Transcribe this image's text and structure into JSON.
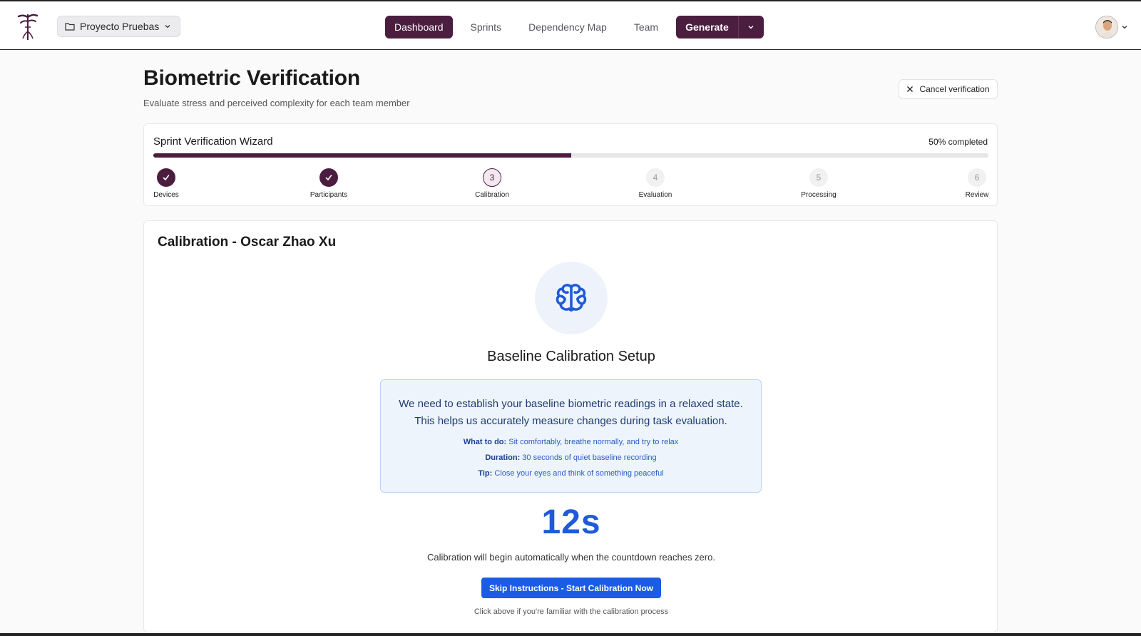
{
  "header": {
    "project_label": "Proyecto Pruebas",
    "nav": [
      {
        "label": "Dashboard",
        "active": true
      },
      {
        "label": "Sprints"
      },
      {
        "label": "Dependency Map"
      },
      {
        "label": "Team"
      }
    ],
    "generate_label": "Generate"
  },
  "page": {
    "title": "Biometric Verification",
    "subtitle": "Evaluate stress and perceived complexity for each team member",
    "cancel_label": "Cancel verification"
  },
  "wizard": {
    "title": "Sprint Verification Wizard",
    "progress_text": "50% completed",
    "progress_fraction": 0.5,
    "steps": [
      {
        "number": "1",
        "label": "Devices",
        "state": "done"
      },
      {
        "number": "2",
        "label": "Participants",
        "state": "done"
      },
      {
        "number": "3",
        "label": "Calibration",
        "state": "current"
      },
      {
        "number": "4",
        "label": "Evaluation",
        "state": "todo"
      },
      {
        "number": "5",
        "label": "Processing",
        "state": "todo"
      },
      {
        "number": "6",
        "label": "Review",
        "state": "todo"
      }
    ]
  },
  "calibration": {
    "title": "Calibration - Oscar Zhao Xu",
    "setup_title": "Baseline Calibration Setup",
    "info_main_1": "We need to establish your baseline biometric readings in a relaxed state.",
    "info_main_2": "This helps us accurately measure changes during task evaluation.",
    "what_label": "What to do:",
    "what_text": "Sit comfortably, breathe normally, and try to relax",
    "duration_label": "Duration:",
    "duration_text": "30 seconds of quiet baseline recording",
    "tip_label": "Tip:",
    "tip_text": "Close your eyes and think of something peaceful",
    "countdown": "12s",
    "auto_note": "Calibration will begin automatically when the countdown reaches zero.",
    "skip_label": "Skip Instructions - Start Calibration Now",
    "skip_note": "Click above if you're familiar with the calibration process"
  },
  "colors": {
    "brand": "#4b1d3f",
    "accent_blue": "#1a5ce5",
    "info_bg": "#eef4fc"
  },
  "icons": {
    "logo": "tree-logo-icon",
    "project": "folder-icon",
    "cancel": "close-icon",
    "done": "check-icon",
    "brain": "brain-icon"
  }
}
